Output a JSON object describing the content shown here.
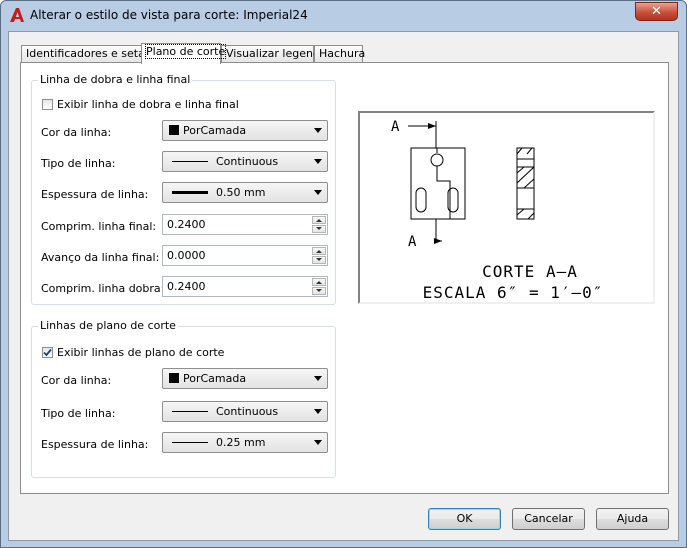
{
  "window": {
    "title": "Alterar o estilo de vista para corte: Imperial24",
    "close_glyph": "✕",
    "icon": "autocad-logo-icon"
  },
  "tabs": [
    {
      "label": "Identificadores e setas",
      "active": false
    },
    {
      "label": "Plano de corte",
      "active": true
    },
    {
      "label": "Visualizar legenda",
      "active": false
    },
    {
      "label": "Hachura",
      "active": false
    }
  ],
  "fold_group": {
    "title": "Linha de dobra e linha final",
    "show_checkbox_label": "Exibir linha de dobra e linha final",
    "show_checked": false,
    "color_label": "Cor da linha:",
    "color_value": "PorCamada",
    "linetype_label": "Tipo de linha:",
    "linetype_value": "Continuous",
    "lineweight_label": "Espessura de linha:",
    "lineweight_value": "0.50 mm",
    "end_length_label": "Comprim. linha final:",
    "end_length_value": "0.2400",
    "end_overshoot_label": "Avanço da linha final:",
    "end_overshoot_value": "0.0000",
    "bend_length_label": "Comprim. linha dobra:",
    "bend_length_value": "0.2400"
  },
  "plane_group": {
    "title": "Linhas de plano de corte",
    "show_checkbox_label": "Exibir linhas de plano de corte",
    "show_checked": true,
    "color_label": "Cor da linha:",
    "color_value": "PorCamada",
    "linetype_label": "Tipo de linha:",
    "linetype_value": "Continuous",
    "lineweight_label": "Espessura de linha:",
    "lineweight_value": "0.25 mm"
  },
  "preview": {
    "label_top": "A",
    "label_bottom": "A",
    "caption_line1": "CORTE A–A",
    "caption_line2": "ESCALA 6″ = 1′–0″"
  },
  "buttons": {
    "ok": "OK",
    "cancel": "Cancelar",
    "help": "Ajuda"
  },
  "colors": {
    "title_bar": "#b8cde3",
    "close_button": "#c9503b",
    "dialog_bg": "#f0f0f0",
    "default_button_border": "#3c7fb1"
  }
}
